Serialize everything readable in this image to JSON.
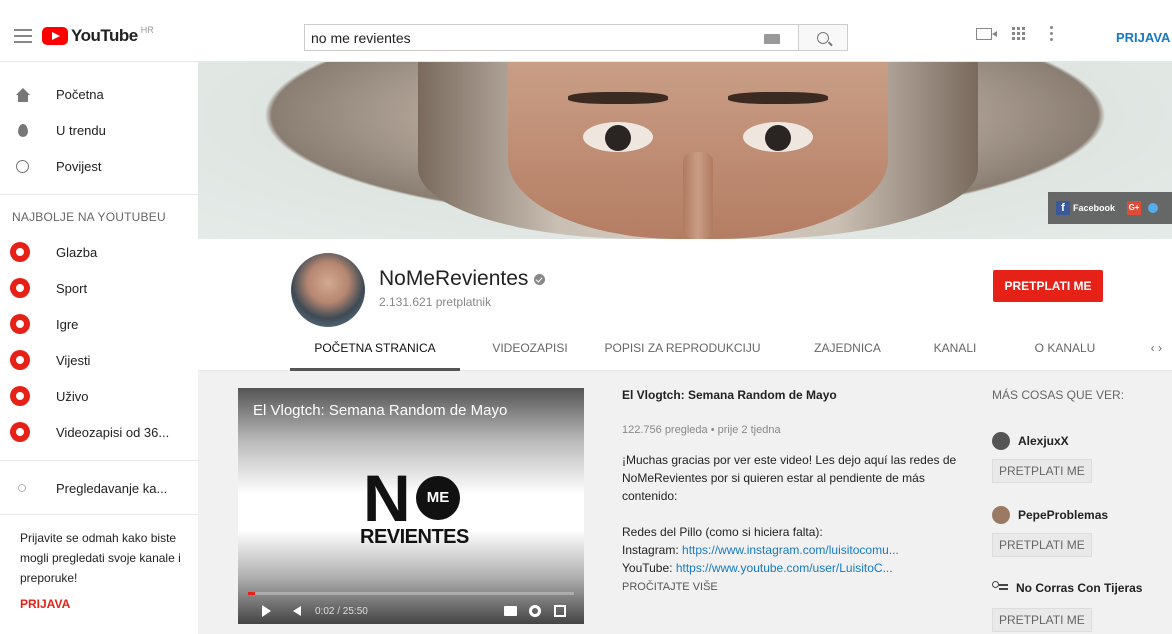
{
  "header": {
    "logo_text": "YouTube",
    "logo_region": "HR",
    "search_value": "no me revientes",
    "signin_label": "PRIJAVA"
  },
  "sidebar": {
    "nav": [
      {
        "label": "Početna",
        "icon": "home-icon"
      },
      {
        "label": "U trendu",
        "icon": "trending-icon"
      },
      {
        "label": "Povijest",
        "icon": "history-icon"
      }
    ],
    "section_title": "NAJBOLJE NA YOUTUBEU",
    "best_of": [
      {
        "label": "Glazba",
        "icon": "music-icon"
      },
      {
        "label": "Sport",
        "icon": "sport-icon"
      },
      {
        "label": "Igre",
        "icon": "gaming-icon"
      },
      {
        "label": "Vijesti",
        "icon": "news-icon"
      },
      {
        "label": "Uživo",
        "icon": "live-icon"
      },
      {
        "label": "Videozapisi od 36...",
        "icon": "360-video-icon"
      }
    ],
    "browse_label": "Pregledavanje ka...",
    "signin_note": "Prijavite se odmah kako biste mogli pregledati svoje kanale i preporuke!",
    "signin_link": "PRIJAVA"
  },
  "banner": {
    "facebook_label": "Facebook",
    "facebook_letter": "f",
    "gplus_label": "G+"
  },
  "channel": {
    "name": "NoMeRevientes",
    "subscribers": "2.131.621 pretplatnik",
    "subscribe_label": "PRETPLATI ME",
    "tabs": [
      "POČETNA STRANICA",
      "VIDEOZAPISI",
      "POPISI ZA REPRODUKCIJU",
      "ZAJEDNICA",
      "KANALI",
      "O KANALU"
    ],
    "active_tab": "POČETNA STRANICA",
    "tab_arrows": "‹  ›"
  },
  "video": {
    "title_overlay": "El Vlogtch: Semana Random de Mayo",
    "logo_n": "N",
    "logo_me": "ME",
    "logo_revientes": "REVIENTES",
    "time": "0:02 / 25:50",
    "progress_fraction": 0.0013
  },
  "video_info": {
    "title": "El Vlogtch: Semana Random de Mayo",
    "meta": "122.756 pregleda • prije 2 tjedna",
    "description": "¡Muchas gracias por ver este video! Les dejo aquí las redes de NoMeRevientes por si quieren estar al pendiente de más contenido:",
    "redes_line": "Redes del Pillo (como si hiciera falta):",
    "instagram_prefix": "Instagram: ",
    "instagram_link": "https://www.instagram.com/luisitocomu...",
    "youtube_prefix": "YouTube: ",
    "youtube_link": "https://www.youtube.com/user/LuisitoC...",
    "read_more": "PROČITAJTE VIŠE"
  },
  "related": {
    "heading": "MÁS COSAS QUE VER:",
    "channels": [
      {
        "name": "AlexjuxX",
        "subscribe_label": "PRETPLATI ME"
      },
      {
        "name": "PepeProblemas",
        "subscribe_label": "PRETPLATI ME"
      },
      {
        "name": "No Corras Con Tijeras",
        "subscribe_label": "PRETPLATI ME"
      }
    ]
  }
}
